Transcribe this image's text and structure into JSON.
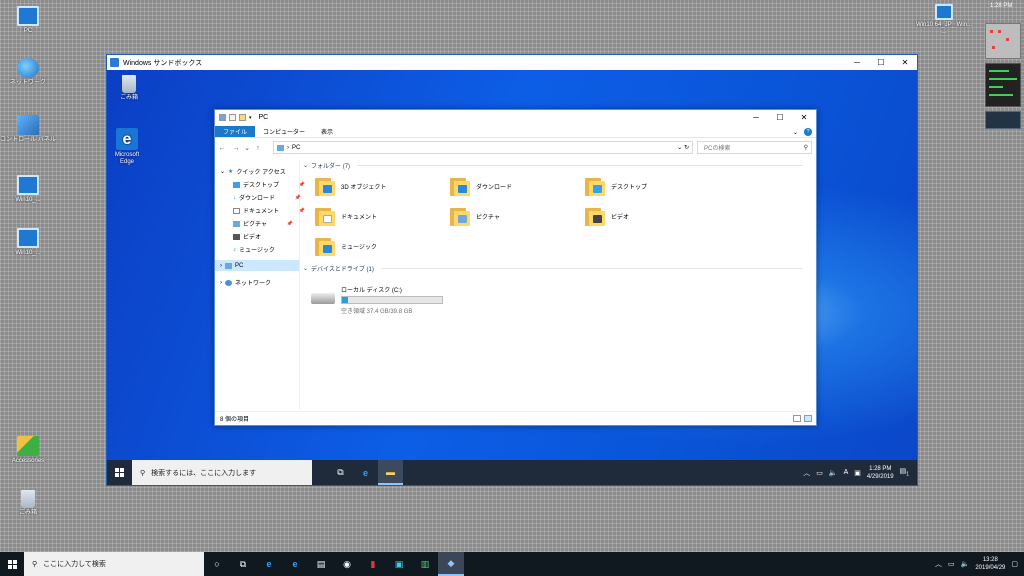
{
  "host_desktop": {
    "icons_left": [
      {
        "label": "PC",
        "icon": "monitor-icon"
      },
      {
        "label": "ネットワーク",
        "icon": "network-icon"
      },
      {
        "label": "コントロール パネル",
        "icon": "control-panel-icon"
      },
      {
        "label": "Win10_...",
        "icon": "monitor-icon"
      },
      {
        "label": "Win10_...",
        "icon": "monitor-icon"
      },
      {
        "label": "Accessories",
        "icon": "folder-icon"
      },
      {
        "label": "ごみ箱",
        "icon": "recycle-bin-icon"
      }
    ],
    "icon_right": {
      "label": "Win10 64_JP_ Win... ...",
      "icon": "computer-icon"
    },
    "top_clock": "1:28 PM"
  },
  "sandbox": {
    "window_title": "Windows サンドボックス",
    "desktop_icons": [
      {
        "label": "ごみ箱",
        "icon": "recycle-bin-icon"
      },
      {
        "label": "Microsoft Edge",
        "icon": "edge-icon"
      }
    ],
    "taskbar": {
      "search_placeholder": "検索するには、ここに入力します",
      "tray_ime": "A",
      "time": "1:28 PM",
      "date": "4/29/2019",
      "notification_count": "1"
    }
  },
  "explorer": {
    "title": "PC",
    "ribbon_tabs": [
      "ファイル",
      "コンピューター",
      "表示"
    ],
    "address": "PC",
    "search_placeholder": "PCの検索",
    "nav": {
      "quick_access": "クイック アクセス",
      "items": [
        "デスクトップ",
        "ダウンロード",
        "ドキュメント",
        "ピクチャ",
        "ビデオ",
        "ミュージック"
      ],
      "pc": "PC",
      "network": "ネットワーク"
    },
    "folders_header": "フォルダー (7)",
    "folders": [
      {
        "name": "3D オブジェクト",
        "badge": "#2b88d8"
      },
      {
        "name": "ダウンロード",
        "badge": "#2b88d8"
      },
      {
        "name": "デスクトップ",
        "badge": "#39a0e6"
      },
      {
        "name": "ドキュメント",
        "badge": "#ffffff"
      },
      {
        "name": "ピクチャ",
        "badge": "#6fa8dc"
      },
      {
        "name": "ビデオ",
        "badge": "#444444"
      },
      {
        "name": "ミュージック",
        "badge": "#2b88d8"
      }
    ],
    "drives_header": "デバイスとドライブ (1)",
    "drive": {
      "name": "ローカル ディスク (C:)",
      "free_text": "空き領域 37.4 GB/39.8 GB",
      "used_fraction": 0.06
    },
    "status": "8 個の項目"
  },
  "host_taskbar": {
    "search_placeholder": "ここに入力して検索",
    "time": "13:28",
    "date": "2019/04/29"
  },
  "colors": {
    "accent": "#1979ca",
    "sandbox_bg": "#0a4fd6",
    "taskbar": "#101820"
  }
}
